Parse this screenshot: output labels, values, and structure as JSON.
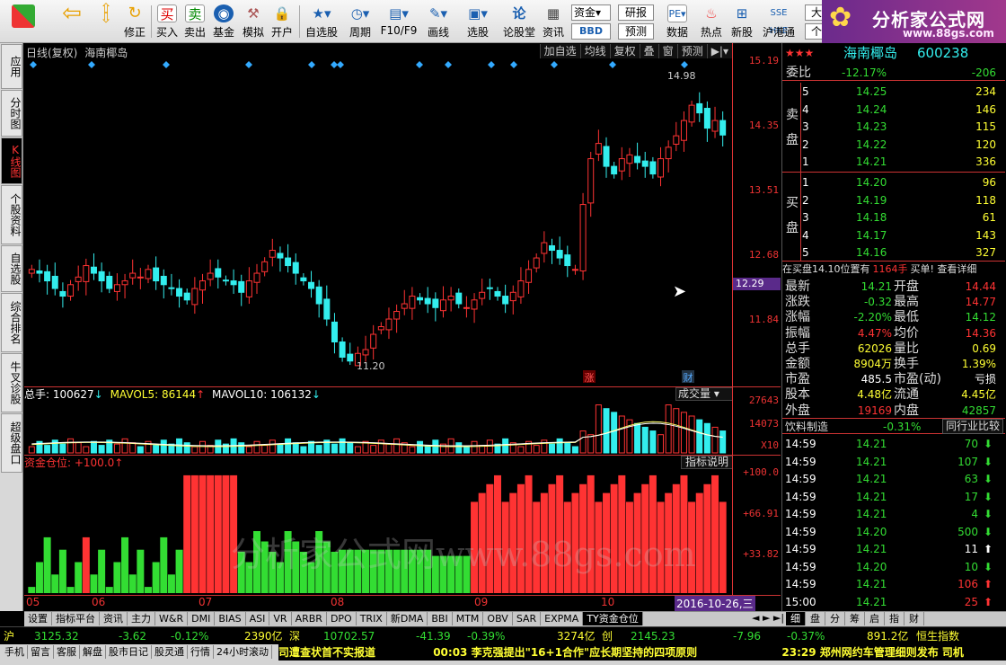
{
  "toolbar": {
    "items": [
      {
        "label": "",
        "icon": "grid-icon"
      },
      {
        "label": "",
        "icon": "back-arrow-icon"
      },
      {
        "label": "修正",
        "icon": "refresh-icon"
      },
      {
        "label": "买入",
        "icon": "buy-icon",
        "glyph": "买"
      },
      {
        "label": "卖出",
        "icon": "sell-icon",
        "glyph": "卖"
      },
      {
        "label": "基金",
        "icon": "fund-icon"
      },
      {
        "label": "模拟",
        "icon": "hammer-icon"
      },
      {
        "label": "开户",
        "icon": "lock-icon"
      },
      {
        "label": "自选股",
        "icon": "star-icon"
      },
      {
        "label": "周期",
        "icon": "clock-icon"
      },
      {
        "label": "F10/F9",
        "icon": "chart-icon"
      },
      {
        "label": "画线",
        "icon": "pen-icon"
      },
      {
        "label": "选股",
        "icon": "monitor-icon"
      },
      {
        "label": "论股堂",
        "icon": "forum-icon"
      },
      {
        "label": "资讯",
        "icon": "news-icon"
      }
    ],
    "fund_btn": "资金",
    "bbd_btn": "BBD",
    "research_btn": "研报",
    "forecast_btn": "预测",
    "data_label": "数据",
    "hot_label": "热点",
    "newstock_label": "新股",
    "hk_label": "沪港通",
    "big_label": "大",
    "ge_label": "个"
  },
  "logo": {
    "title": "分析家公式网",
    "url": "www.88gs.com"
  },
  "left_tabs": [
    "应用",
    "分时图",
    "K线图",
    "个股资料",
    "自选股",
    "综合排名",
    "牛叉诊股",
    "超级盘口"
  ],
  "chart": {
    "title": "日线(复权)",
    "stock": "海南椰岛",
    "buttons": [
      "加自选",
      "均线",
      "复权",
      "叠",
      "窗",
      "预测"
    ],
    "price_ticks": [
      "15.19",
      "14.35",
      "13.51",
      "12.68",
      "11.84"
    ],
    "current_price": "12.29",
    "high_label": "14.98",
    "low_label": "11.20",
    "zhang_tag": "涨",
    "cai_tag": "财",
    "vol_header": {
      "total": "总手: 100627",
      "mavol5": "MAVOL5: 86144",
      "mavol10": "MAVOL10: 106132"
    },
    "vol_selector": "成交量",
    "vol_ticks": [
      "27643",
      "14073",
      "X10"
    ],
    "ind_header": "资金仓位: +100.0",
    "ind_button": "指标说明",
    "ind_ticks": [
      "+100.0",
      "+66.91",
      "+33.82"
    ],
    "months": [
      "05",
      "06",
      "07",
      "08",
      "09",
      "10"
    ],
    "date_label": "2016-10-26,三",
    "watermark": "分析家公式网www.88gs.com"
  },
  "chart_data": {
    "type": "candlestick",
    "ylim": [
      11.2,
      15.19
    ],
    "closes": [
      12.45,
      12.4,
      12.3,
      12.2,
      12.1,
      12.25,
      12.35,
      12.5,
      12.4,
      12.3,
      12.2,
      12.25,
      12.3,
      12.4,
      12.35,
      12.45,
      12.3,
      12.25,
      12.2,
      12.1,
      12.05,
      12.2,
      12.3,
      12.4,
      12.35,
      12.3,
      12.25,
      12.15,
      12.3,
      12.4,
      12.55,
      12.7,
      12.6,
      12.5,
      12.4,
      12.3,
      12.2,
      12.0,
      11.8,
      11.5,
      11.3,
      11.25,
      11.35,
      11.4,
      11.6,
      11.7,
      11.8,
      11.9,
      12.0,
      12.1,
      12.05,
      12.0,
      11.95,
      12.05,
      12.1,
      12.0,
      11.95,
      12.05,
      12.15,
      12.2,
      12.1,
      12.0,
      12.15,
      12.3,
      12.45,
      12.6,
      12.8,
      12.7,
      12.6,
      12.5,
      12.45,
      13.3,
      13.9,
      14.1,
      13.8,
      13.7,
      13.9,
      13.95,
      13.85,
      13.8,
      13.7,
      13.9,
      14.05,
      14.2,
      14.4,
      14.6,
      14.5,
      14.3,
      14.4,
      14.21
    ],
    "volume_ma_ticks": [
      27643,
      14073
    ]
  },
  "quote": {
    "stars": "★★★",
    "name": "海南椰岛",
    "code": "600238",
    "weibi_label": "委比",
    "weibi": "-12.17%",
    "weicha": "-206",
    "sell_label": "卖盘",
    "buy_label": "买盘",
    "asks": [
      [
        "5",
        "14.25",
        "234"
      ],
      [
        "4",
        "14.24",
        "146"
      ],
      [
        "3",
        "14.23",
        "115"
      ],
      [
        "2",
        "14.22",
        "120"
      ],
      [
        "1",
        "14.21",
        "336"
      ]
    ],
    "bids": [
      [
        "1",
        "14.20",
        "96"
      ],
      [
        "2",
        "14.19",
        "118"
      ],
      [
        "3",
        "14.18",
        "61"
      ],
      [
        "4",
        "14.17",
        "143"
      ],
      [
        "5",
        "14.16",
        "327"
      ]
    ],
    "note_pre": "在买盘14.10位置有",
    "note_val": "1164手",
    "note_post": "买单! 查看详细",
    "stats": [
      [
        "最新",
        "14.21",
        "开盘",
        "14.44"
      ],
      [
        "涨跌",
        "-0.32",
        "最高",
        "14.77"
      ],
      [
        "涨幅",
        "-2.20%",
        "最低",
        "14.12"
      ],
      [
        "振幅",
        "4.47%",
        "均价",
        "14.36"
      ],
      [
        "总手",
        "62026",
        "量比",
        "0.69"
      ],
      [
        "金额",
        "8904万",
        "换手",
        "1.39%"
      ],
      [
        "市盈",
        "485.5",
        "市盈(动)",
        "亏损"
      ],
      [
        "股本",
        "4.48亿",
        "流通",
        "4.45亿"
      ],
      [
        "外盘",
        "19169",
        "内盘",
        "42857"
      ]
    ],
    "industry": "饮料制造",
    "industry_chg": "-0.31%",
    "industry_btn": "同行业比较",
    "ticks": [
      [
        "14:59",
        "14.21",
        "70",
        "down"
      ],
      [
        "14:59",
        "14.21",
        "107",
        "down"
      ],
      [
        "14:59",
        "14.21",
        "63",
        "down"
      ],
      [
        "14:59",
        "14.21",
        "17",
        "down"
      ],
      [
        "14:59",
        "14.21",
        "4",
        "down"
      ],
      [
        "14:59",
        "14.20",
        "500",
        "down"
      ],
      [
        "14:59",
        "14.21",
        "11",
        "up-w"
      ],
      [
        "14:59",
        "14.20",
        "10",
        "down"
      ],
      [
        "14:59",
        "14.21",
        "106",
        "up"
      ],
      [
        "15:00",
        "14.21",
        "25",
        "up"
      ]
    ]
  },
  "bottom_tabs": [
    "设置",
    "指标平台",
    "资讯",
    "主力",
    "W&R",
    "DMI",
    "BIAS",
    "ASI",
    "VR",
    "ARBR",
    "DPO",
    "TRIX",
    "新DMA",
    "BBI",
    "MTM",
    "OBV",
    "SAR",
    "EXPMA",
    "TY资金仓位"
  ],
  "right_tabs": [
    "细",
    "盘",
    "分",
    "筹",
    "启",
    "指",
    "财"
  ],
  "status1": {
    "sh_label": "沪",
    "sh": "3125.32",
    "sh_chg": "-3.62",
    "sh_pct": "-0.12%",
    "sh_amt": "2390亿",
    "sz_label": "深",
    "sz": "10702.57",
    "sz_chg": "-41.39",
    "sz_pct": "-0.39%",
    "sz_amt": "3274亿",
    "cy_label": "创",
    "cy": "2145.23",
    "cy_chg": "-7.96",
    "cy_pct": "-0.37%",
    "cy_amt": "891.2亿",
    "hs_label": "恒生指数"
  },
  "status2": {
    "items": [
      "手机",
      "留言",
      "客服",
      "解盘",
      "股市日记",
      "股灵通",
      "行情",
      "24小时滚动"
    ],
    "news1": "司遭查状首不实报道",
    "news2": "00:03 李克强提出\"16+1合作\"应长期坚持的四项原则",
    "news3": "23:29 郑州网约车管理细则发布 司机"
  }
}
